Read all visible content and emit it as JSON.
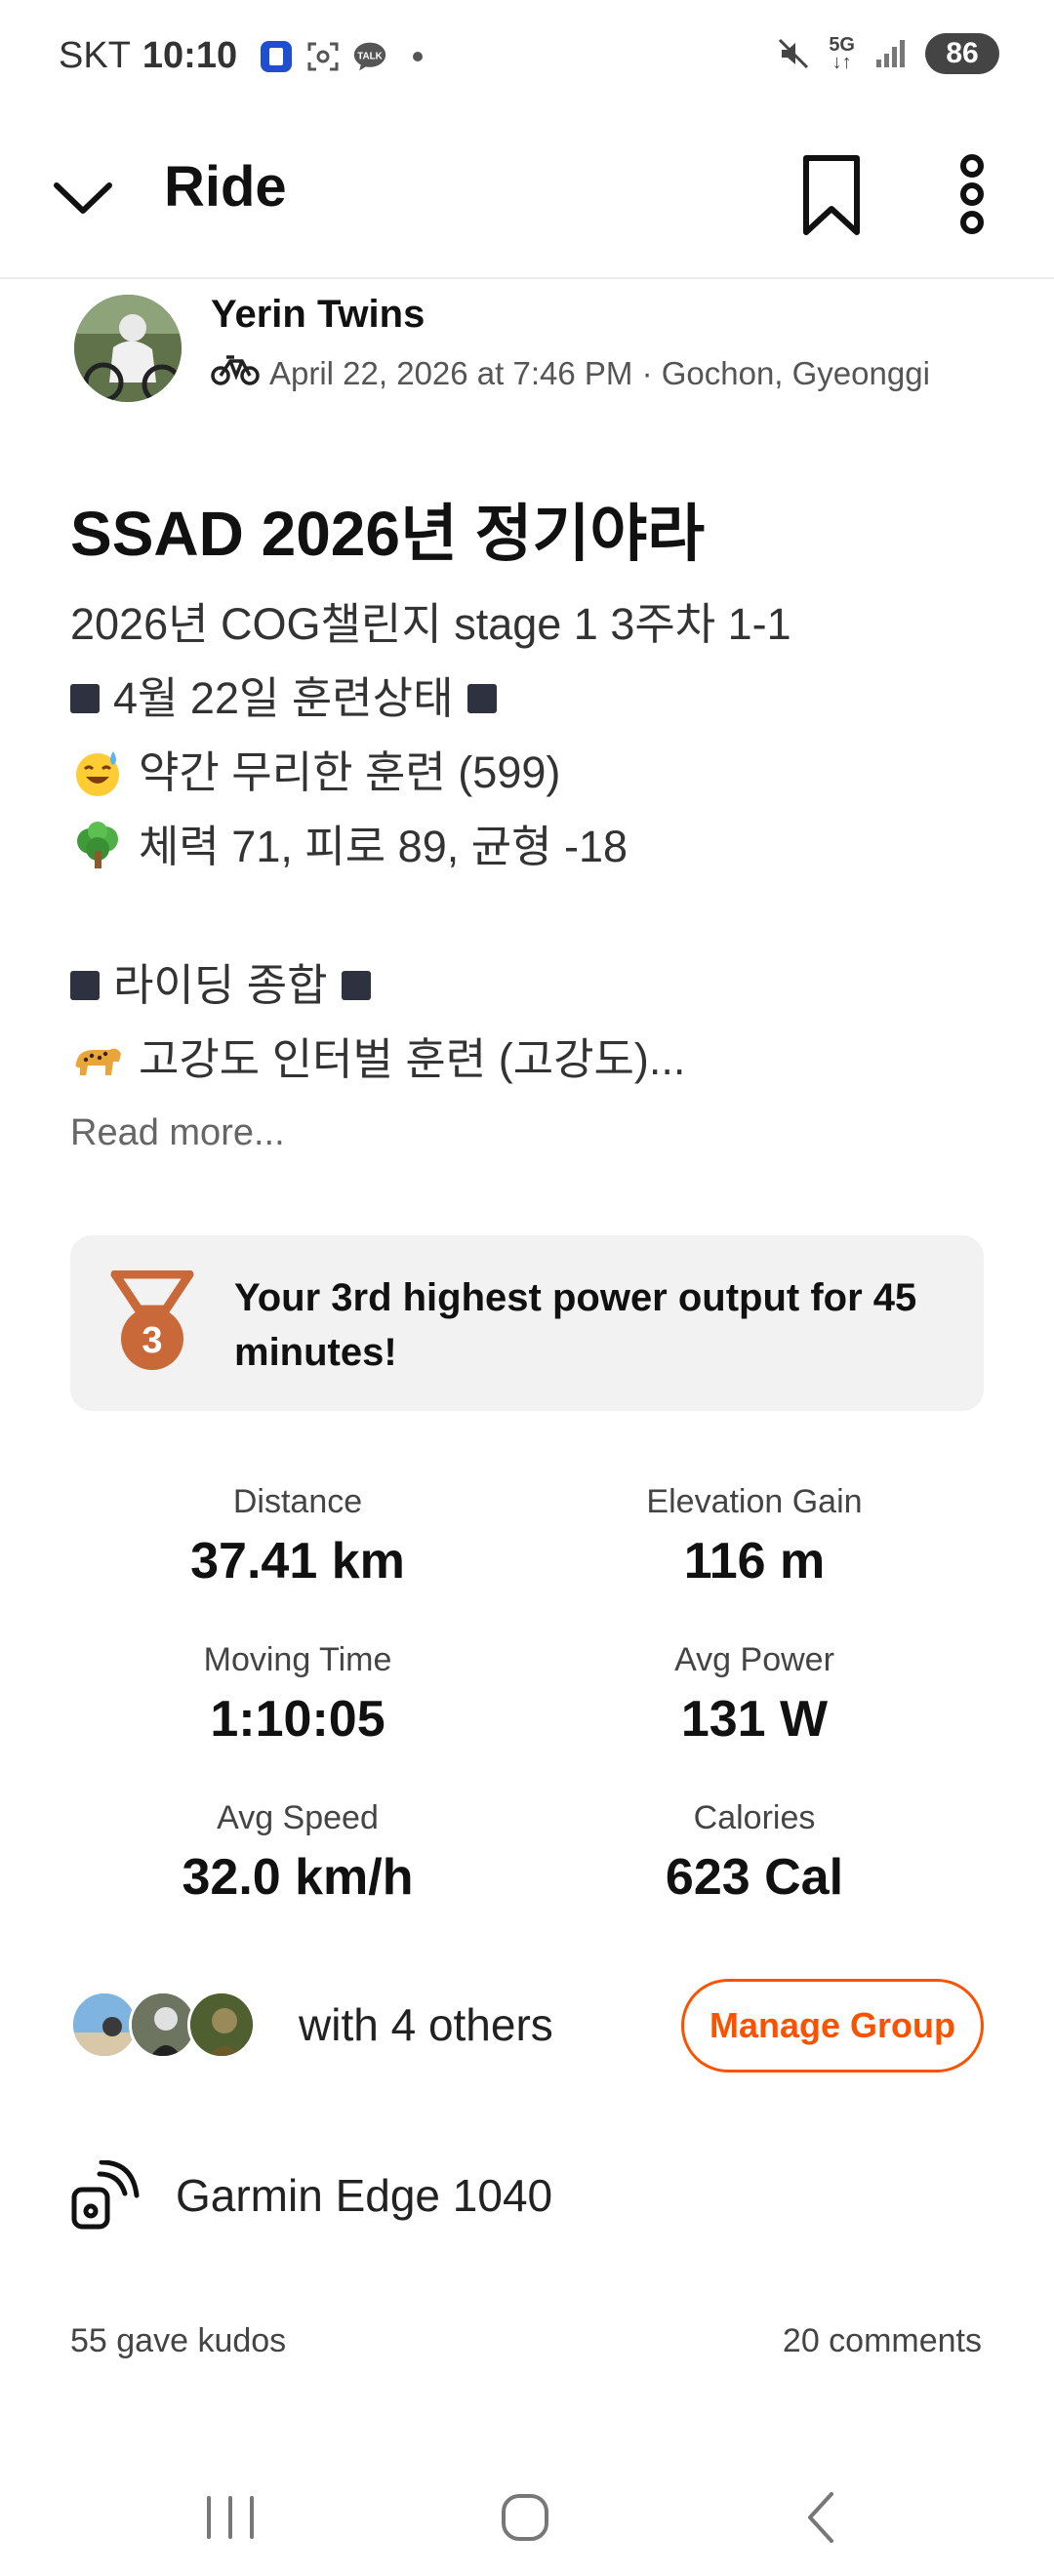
{
  "status_bar": {
    "carrier": "SKT",
    "time": "10:10",
    "network": "5G",
    "battery": "86",
    "notif_talk": "TALK"
  },
  "app_bar": {
    "title": "Ride"
  },
  "athlete": {
    "name": "Yerin Twins",
    "meta": "April 22, 2026 at 7:46 PM · Gochon, Gyeonggi"
  },
  "activity": {
    "title": "SSAD 2026년 정기야라",
    "description_lines": [
      "2026년 COG챌린지 stage 1 3주차 1-1",
      "4월 22일 훈련상태",
      "약간 무리한 훈련 (599)",
      "체력 71, 피로 89, 균형 -18",
      "라이딩 종합",
      "고강도 인터벌 훈련 (고강도)..."
    ],
    "read_more": "Read more..."
  },
  "achievement": {
    "rank": "3",
    "text": "Your 3rd highest power output for 45 minutes!"
  },
  "stats": [
    {
      "label": "Distance",
      "value": "37.41 km"
    },
    {
      "label": "Elevation Gain",
      "value": "116 m"
    },
    {
      "label": "Moving Time",
      "value": "1:10:05"
    },
    {
      "label": "Avg Power",
      "value": "131 W"
    },
    {
      "label": "Avg Speed",
      "value": "32.0 km/h"
    },
    {
      "label": "Calories",
      "value": "623 Cal"
    }
  ],
  "group": {
    "text": "with 4 others",
    "button": "Manage Group"
  },
  "device": {
    "name": "Garmin Edge 1040"
  },
  "social": {
    "kudos": "55 gave kudos",
    "comments": "20 comments"
  },
  "colors": {
    "accent": "#fc5200",
    "medal": "#c9693a",
    "card_bg": "#f2f2f2"
  }
}
